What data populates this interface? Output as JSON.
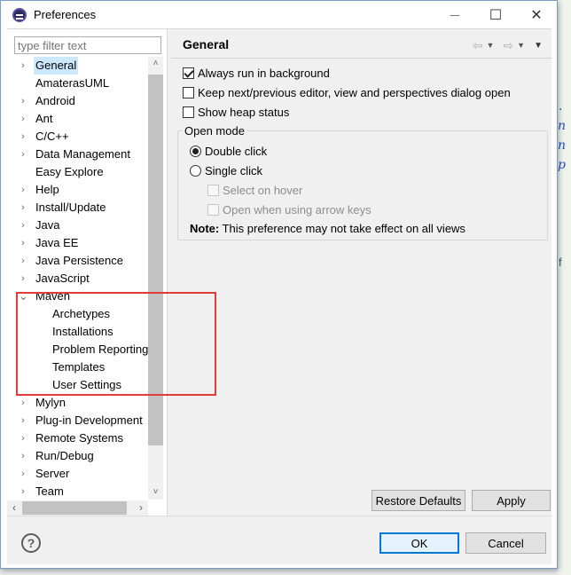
{
  "window": {
    "title": "Preferences",
    "minimize": "—",
    "maximize": "☐",
    "close": "✕"
  },
  "filter": {
    "placeholder": "type filter text"
  },
  "tree": {
    "items": [
      {
        "label": "General",
        "expander": "›",
        "selected": true
      },
      {
        "label": "AmaterasUML",
        "expander": ""
      },
      {
        "label": "Android",
        "expander": "›"
      },
      {
        "label": "Ant",
        "expander": "›"
      },
      {
        "label": "C/C++",
        "expander": "›"
      },
      {
        "label": "Data Management",
        "expander": "›"
      },
      {
        "label": "Easy Explore",
        "expander": ""
      },
      {
        "label": "Help",
        "expander": "›"
      },
      {
        "label": "Install/Update",
        "expander": "›"
      },
      {
        "label": "Java",
        "expander": "›"
      },
      {
        "label": "Java EE",
        "expander": "›"
      },
      {
        "label": "Java Persistence",
        "expander": "›"
      },
      {
        "label": "JavaScript",
        "expander": "›"
      },
      {
        "label": "Maven",
        "expander": "⌄"
      },
      {
        "label": "Archetypes",
        "child": true
      },
      {
        "label": "Installations",
        "child": true
      },
      {
        "label": "Problem Reporting",
        "child": true
      },
      {
        "label": "Templates",
        "child": true
      },
      {
        "label": "User Settings",
        "child": true
      },
      {
        "label": "Mylyn",
        "expander": "›"
      },
      {
        "label": "Plug-in Development",
        "expander": "›"
      },
      {
        "label": "Remote Systems",
        "expander": "›"
      },
      {
        "label": "Run/Debug",
        "expander": "›"
      },
      {
        "label": "Server",
        "expander": "›"
      },
      {
        "label": "Team",
        "expander": "›"
      }
    ],
    "scroll_up": "˄",
    "scroll_down": "˅",
    "scroll_left": "‹",
    "scroll_right": "›"
  },
  "page": {
    "title": "General",
    "nav_back": "⇦",
    "nav_forward": "⇨",
    "dropdown": "▼",
    "menu": "▼",
    "options": [
      {
        "label": "Always run in background",
        "checked": true
      },
      {
        "label": "Keep next/previous editor, view and perspectives dialog open",
        "checked": false
      },
      {
        "label": "Show heap status",
        "checked": false
      }
    ],
    "open_mode": {
      "legend": "Open mode",
      "double_click": "Double click",
      "single_click": "Single click",
      "select_on_hover": "Select on hover",
      "open_arrow_keys": "Open when using arrow keys",
      "note_label": "Note:",
      "note_text": " This preference may not take effect on all views"
    },
    "restore_defaults": "Restore Defaults",
    "apply": "Apply"
  },
  "footer": {
    "help": "?",
    "ok": "OK",
    "cancel": "Cancel"
  },
  "background": {
    "fragments": [
      ".",
      "n",
      "n",
      "p",
      "f"
    ]
  },
  "colors": {
    "selection": "#cce8ff",
    "default_button_border": "#0078d7",
    "annotation": "#e03c3c"
  }
}
